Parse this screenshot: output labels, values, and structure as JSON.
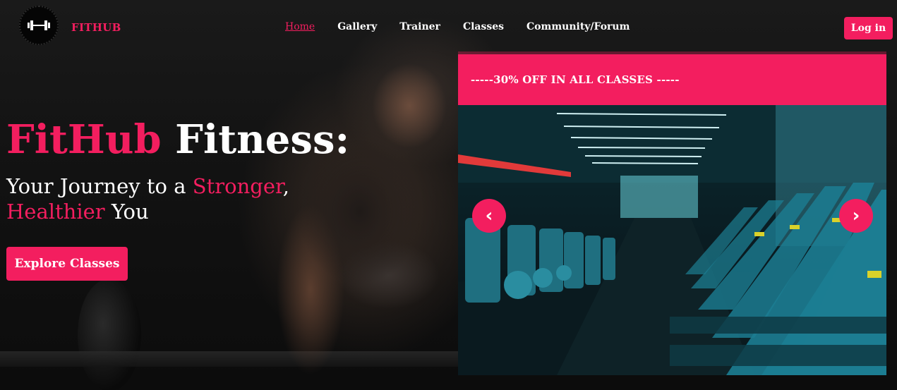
{
  "navbar": {
    "brand": "FITHUB",
    "logo_icon": "dumbbell-icon",
    "links": [
      {
        "label": "Home",
        "active": true
      },
      {
        "label": "Gallery",
        "active": false
      },
      {
        "label": "Trainer",
        "active": false
      },
      {
        "label": "Classes",
        "active": false
      },
      {
        "label": "Community/Forum",
        "active": false
      }
    ],
    "login_label": "Log in"
  },
  "hero": {
    "title_highlight": "FitHub",
    "title_rest": " Fitness:",
    "subtitle_part1": "Your Journey to a ",
    "subtitle_highlight1": "Stronger",
    "subtitle_part2": ", ",
    "subtitle_highlight2": "Healthier",
    "subtitle_part3": " You",
    "cta_label": "Explore Classes"
  },
  "promo": {
    "text": "-----30% OFF IN ALL CLASSES -----"
  },
  "carousel": {
    "prev_symbol": "‹",
    "next_symbol": "›",
    "image_subject": "gym-interior-with-treadmills"
  },
  "colors": {
    "accent": "#f31e5f",
    "background": "#0e0e0e",
    "text": "#ffffff"
  }
}
